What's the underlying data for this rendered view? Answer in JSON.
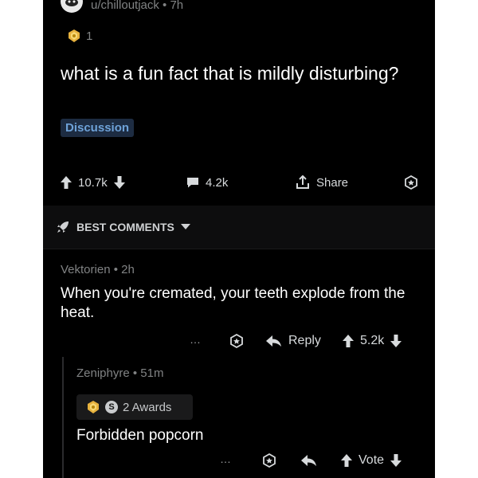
{
  "post": {
    "author_meta": "u/chilloutjack • 7h",
    "award_count": "1",
    "title": "what is a fun fact that is mildly disturbing?",
    "flair": "Discussion",
    "actions": {
      "upvotes": "10.7k",
      "comments": "4.2k",
      "share_label": "Share"
    }
  },
  "comments_header": {
    "sort_label": "BEST COMMENTS"
  },
  "comment1": {
    "meta": "Vektorien • 2h",
    "body": "When you're cremated, your teeth explode from the heat.",
    "more": "…",
    "reply_label": "Reply",
    "score": "5.2k"
  },
  "comment2": {
    "meta": "Zeniphyre • 51m",
    "awards_label": "2 Awards",
    "silver_letter": "S",
    "body": "Forbidden popcorn",
    "more": "…",
    "vote_label": "Vote"
  },
  "colors": {
    "background": "#000000",
    "text": "#ffffff",
    "meta": "#818384",
    "flair_bg": "#1d2c42",
    "flair_text": "#6ea2d8",
    "award_gold": "#e7b23e"
  },
  "icons": [
    "subreddit-avatar-icon",
    "gold-award-icon",
    "upvote-arrow-icon",
    "downvote-arrow-icon",
    "comment-bubble-icon",
    "share-icon",
    "award-outline-icon",
    "rocket-icon",
    "caret-down-icon",
    "reply-arrow-icon",
    "silver-award-icon"
  ]
}
